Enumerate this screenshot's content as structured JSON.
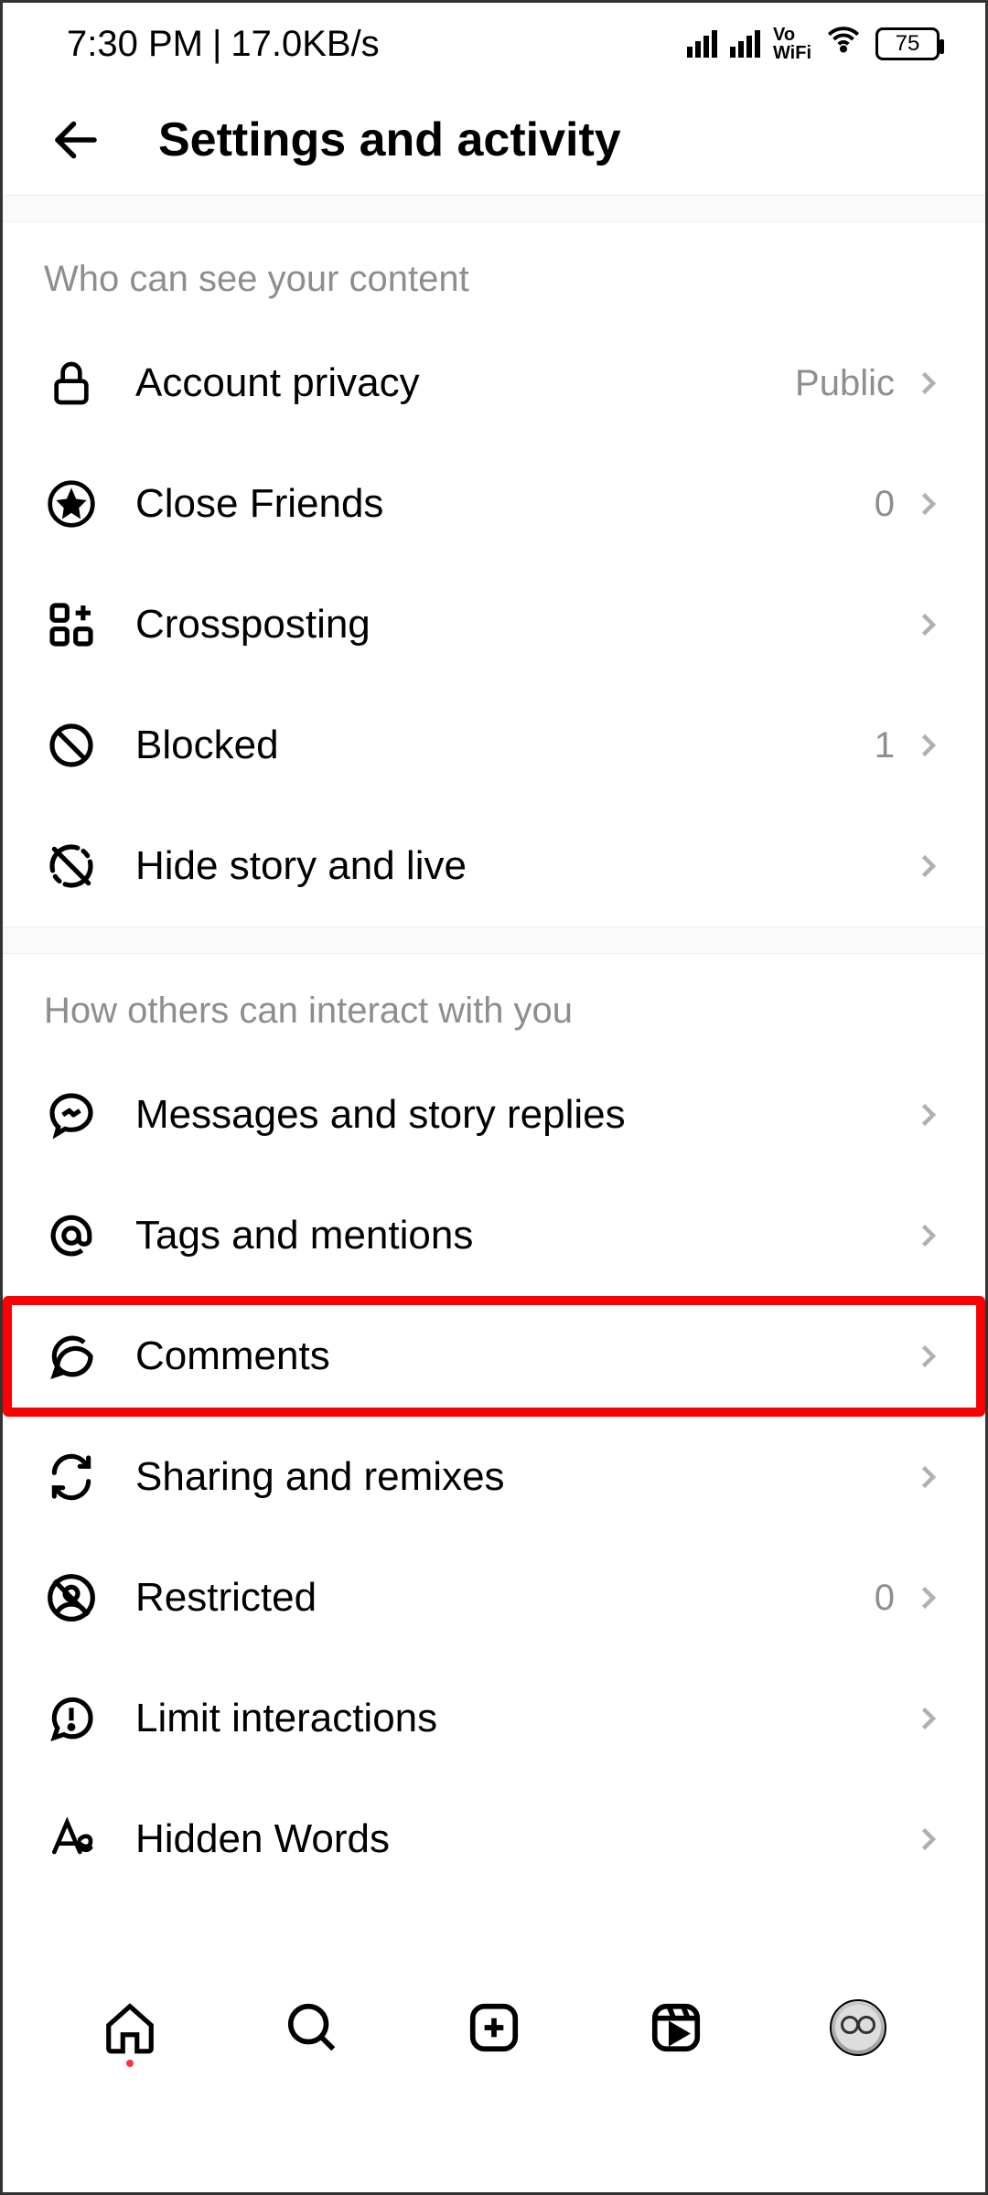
{
  "status": {
    "time": "7:30 PM",
    "speed": "17.0KB/s",
    "vowifi_top": "Vo",
    "vowifi_bottom": "WiFi",
    "battery": "75"
  },
  "header": {
    "title": "Settings and activity"
  },
  "sections": [
    {
      "title": "Who can see your content",
      "items": [
        {
          "icon": "lock-icon",
          "label": "Account privacy",
          "value": "Public"
        },
        {
          "icon": "star-circle-icon",
          "label": "Close Friends",
          "value": "0"
        },
        {
          "icon": "crosspost-icon",
          "label": "Crossposting",
          "value": ""
        },
        {
          "icon": "blocked-icon",
          "label": "Blocked",
          "value": "1"
        },
        {
          "icon": "hide-story-icon",
          "label": "Hide story and live",
          "value": ""
        }
      ]
    },
    {
      "title": "How others can interact with you",
      "items": [
        {
          "icon": "messenger-icon",
          "label": "Messages and story replies",
          "value": ""
        },
        {
          "icon": "at-icon",
          "label": "Tags and mentions",
          "value": ""
        },
        {
          "icon": "comment-icon",
          "label": "Comments",
          "value": "",
          "highlight": true
        },
        {
          "icon": "sharing-icon",
          "label": "Sharing and remixes",
          "value": ""
        },
        {
          "icon": "restricted-icon",
          "label": "Restricted",
          "value": "0"
        },
        {
          "icon": "limit-icon",
          "label": "Limit interactions",
          "value": ""
        },
        {
          "icon": "hidden-words-icon",
          "label": "Hidden Words",
          "value": ""
        }
      ]
    }
  ],
  "nav": {
    "items": [
      "home",
      "search",
      "create",
      "reels",
      "profile"
    ]
  }
}
